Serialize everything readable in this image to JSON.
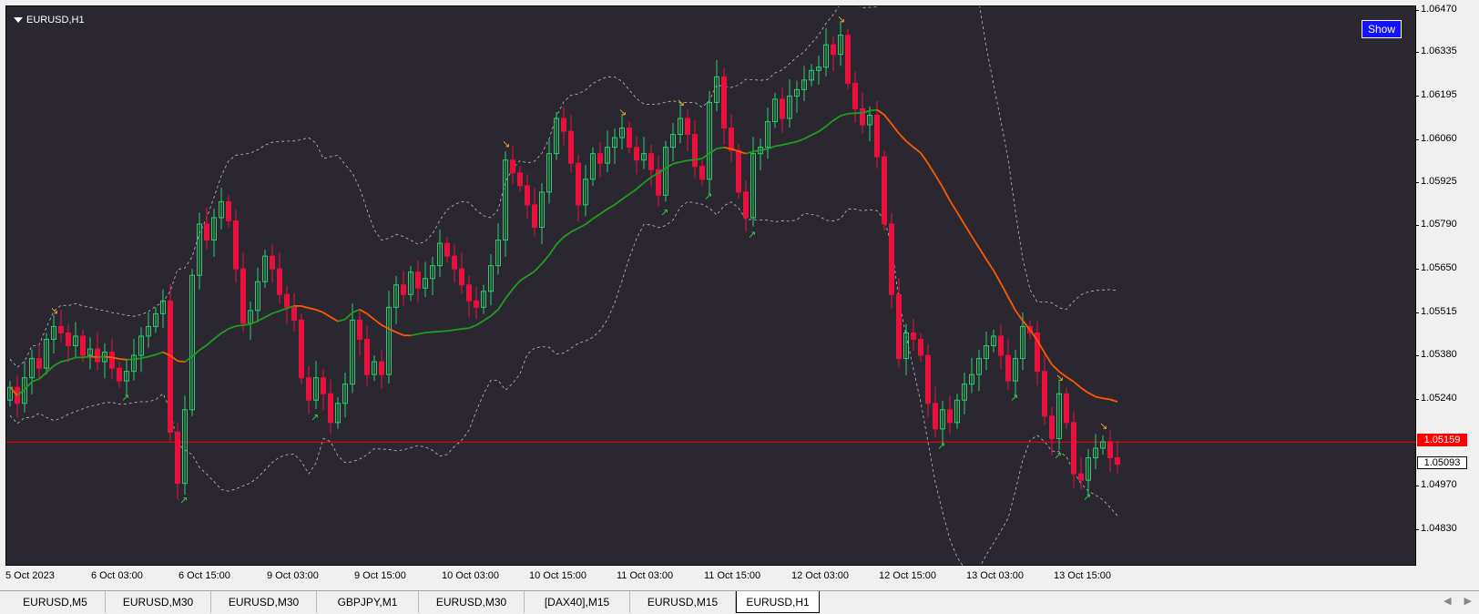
{
  "window": {
    "symbol_title": "EURUSD,H1",
    "show_button": "Show"
  },
  "price_axis": {
    "ticks": [
      "1.06470",
      "1.06335",
      "1.06195",
      "1.06060",
      "1.05925",
      "1.05790",
      "1.05650",
      "1.05515",
      "1.05380",
      "1.05240",
      "1.05093",
      "1.04970",
      "1.04830"
    ],
    "bid_label": "1.05159",
    "ask_label": "1.05093"
  },
  "time_axis": {
    "ticks": [
      "5 Oct 2023",
      "6 Oct 03:00",
      "6 Oct 15:00",
      "9 Oct 03:00",
      "9 Oct 15:00",
      "10 Oct 03:00",
      "10 Oct 15:00",
      "11 Oct 03:00",
      "11 Oct 15:00",
      "12 Oct 03:00",
      "12 Oct 15:00",
      "13 Oct 03:00",
      "13 Oct 15:00"
    ]
  },
  "tabs": [
    {
      "label": "EURUSD,M5",
      "active": false
    },
    {
      "label": "EURUSD,M30",
      "active": false
    },
    {
      "label": "EURUSD,M30",
      "active": false
    },
    {
      "label": "GBPJPY,M1",
      "active": false
    },
    {
      "label": "EURUSD,M30",
      "active": false
    },
    {
      "label": "[DAX40],M15",
      "active": false
    },
    {
      "label": "EURUSD,M15",
      "active": false
    },
    {
      "label": "EURUSD,H1",
      "active": true
    }
  ],
  "colors": {
    "background": "#2a2730",
    "bull": "#2ecc71",
    "bear": "#e8103c",
    "ma_up": "#1f9d1f",
    "ma_down": "#ff5a00",
    "band": "#bfbfbf",
    "bid_line": "#ff0000",
    "signal_buy": "#3ccc3c",
    "signal_sell": "#f5a623"
  },
  "chart_data": {
    "type": "candlestick",
    "symbol": "EURUSD",
    "timeframe": "H1",
    "ylim": [
      1.0477,
      1.0652
    ],
    "bid": 1.05159,
    "ask": 1.05093,
    "close_series": [
      1.0533,
      1.0528,
      1.0536,
      1.0542,
      1.0539,
      1.0548,
      1.0552,
      1.055,
      1.0546,
      1.0549,
      1.0543,
      1.0545,
      1.0541,
      1.0544,
      1.0539,
      1.0535,
      1.0538,
      1.0543,
      1.0549,
      1.0552,
      1.0556,
      1.056,
      1.0519,
      1.0503,
      1.0526,
      1.0568,
      1.0584,
      1.0579,
      1.0586,
      1.0591,
      1.0585,
      1.057,
      1.0553,
      1.0557,
      1.0566,
      1.0574,
      1.057,
      1.0562,
      1.0558,
      1.0554,
      1.0536,
      1.0529,
      1.0536,
      1.0531,
      1.0522,
      1.0528,
      1.0534,
      1.0554,
      1.0548,
      1.0537,
      1.0541,
      1.0537,
      1.0558,
      1.0565,
      1.0562,
      1.0569,
      1.0564,
      1.0567,
      1.0571,
      1.0578,
      1.0574,
      1.057,
      1.0565,
      1.056,
      1.0558,
      1.0563,
      1.0571,
      1.0579,
      1.0604,
      1.06,
      1.0596,
      1.059,
      1.0583,
      1.0594,
      1.0606,
      1.0617,
      1.0613,
      1.0603,
      1.059,
      1.0598,
      1.0606,
      1.0603,
      1.0608,
      1.0611,
      1.0614,
      1.0608,
      1.0604,
      1.0606,
      1.0601,
      1.0593,
      1.0608,
      1.0612,
      1.0617,
      1.0612,
      1.0602,
      1.0598,
      1.0622,
      1.063,
      1.0614,
      1.0607,
      1.0594,
      1.0586,
      1.0606,
      1.0608,
      1.0616,
      1.0623,
      1.0617,
      1.0624,
      1.0626,
      1.0629,
      1.0632,
      1.0633,
      1.064,
      1.0637,
      1.0643,
      1.0628,
      1.062,
      1.0615,
      1.0618,
      1.0605,
      1.0584,
      1.0562,
      1.0542,
      1.055,
      1.0548,
      1.0543,
      1.0528,
      1.052,
      1.0526,
      1.0522,
      1.0529,
      1.0534,
      1.0537,
      1.0542,
      1.0546,
      1.0549,
      1.0543,
      1.0535,
      1.0542,
      1.0552,
      1.055,
      1.0538,
      1.0524,
      1.0517,
      1.0531,
      1.0522,
      1.0506,
      1.0504,
      1.0511,
      1.0514,
      1.0516,
      1.0511,
      1.0509
    ]
  }
}
